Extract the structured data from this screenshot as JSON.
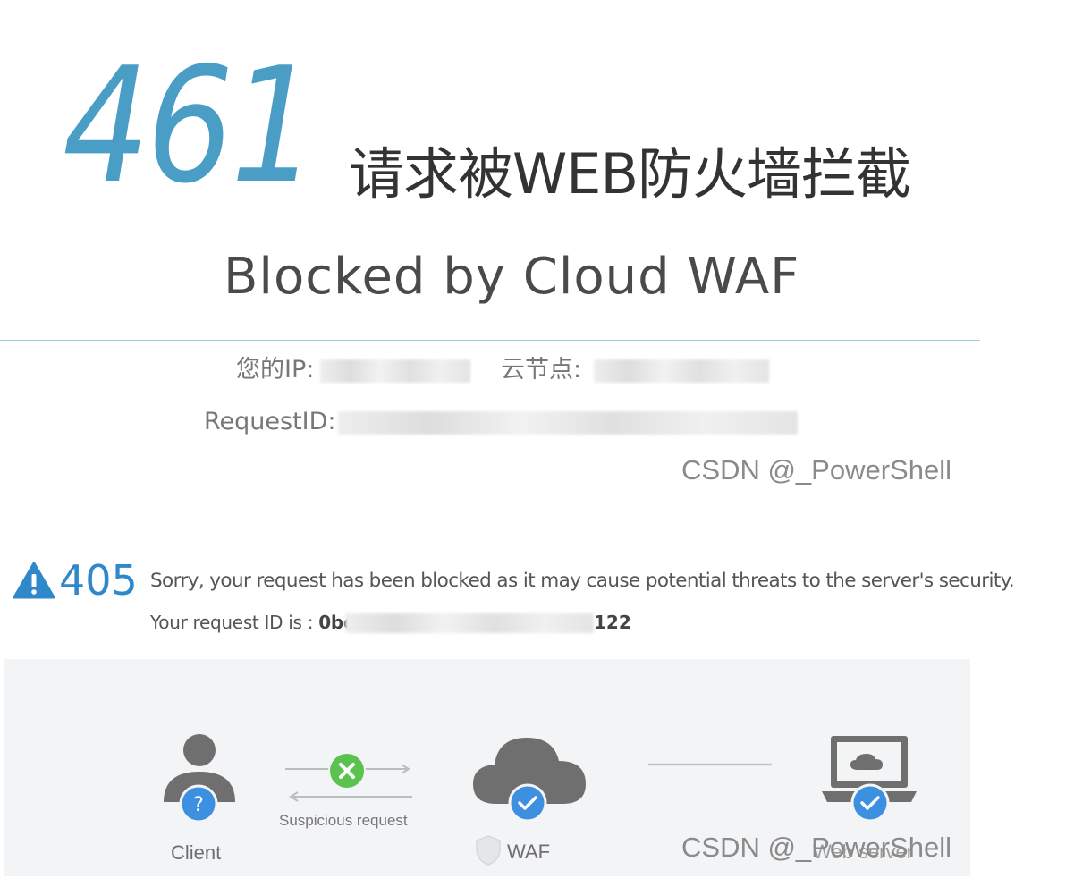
{
  "waf461": {
    "code": "461",
    "title_cn": "请求被WEB防火墙拦截",
    "title_en": "Blocked by Cloud WAF",
    "ip_label": "您的IP:",
    "node_label": "云节点:",
    "request_id_label": "RequestID:"
  },
  "watermark": "CSDN @_PowerShell",
  "waf405": {
    "code": "405",
    "message": "Sorry, your request has been blocked as it may cause potential threats to the server's security.",
    "request_id_label": "Your request ID is :",
    "request_id_prefix": "0bc",
    "request_id_suffix": "122"
  },
  "diagram": {
    "client_label": "Client",
    "suspicious_label": "Suspicious request",
    "waf_label": "WAF",
    "server_label": "Web server"
  },
  "colors": {
    "accent_blue": "#4a9ec6",
    "code405_blue": "#2f88c9",
    "badge_blue": "#3d8fe0",
    "reject_green": "#5cc24f",
    "icon_gray": "#6f6f6f"
  },
  "icons": [
    "warning-icon",
    "client-person-icon",
    "question-badge-icon",
    "reject-x-icon",
    "cloud-icon",
    "check-badge-icon",
    "shield-icon",
    "laptop-icon"
  ]
}
